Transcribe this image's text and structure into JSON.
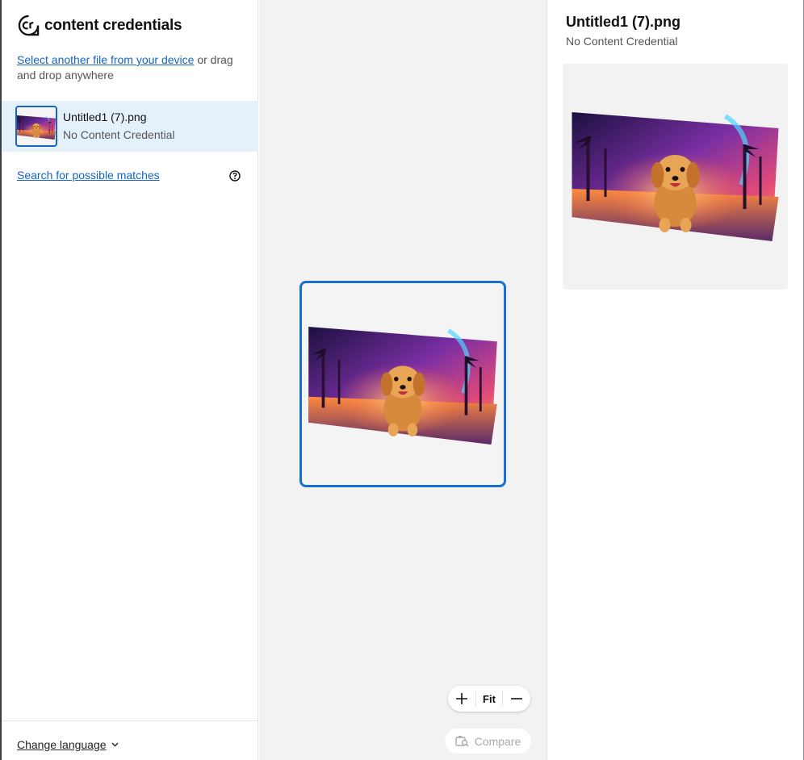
{
  "app": {
    "brand_text": "content credentials",
    "logo_mark": "cr"
  },
  "sidebar": {
    "select_link": "Select another file from your device",
    "drag_text": " or drag and drop anywhere",
    "file": {
      "name": "Untitled1 (7).png",
      "status": "No Content Credential"
    },
    "search_link": "Search for possible matches",
    "change_language": "Change language"
  },
  "canvas": {
    "zoom_in_icon": "plus-icon",
    "fit_label": "Fit",
    "zoom_out_icon": "minus-icon",
    "compare_label": "Compare"
  },
  "panel": {
    "title": "Untitled1 (7).png",
    "subtitle": "No Content Credential"
  },
  "colors": {
    "accent": "#1a6fd6",
    "link": "#1565c0",
    "selected_row": "#e4f1fb"
  }
}
